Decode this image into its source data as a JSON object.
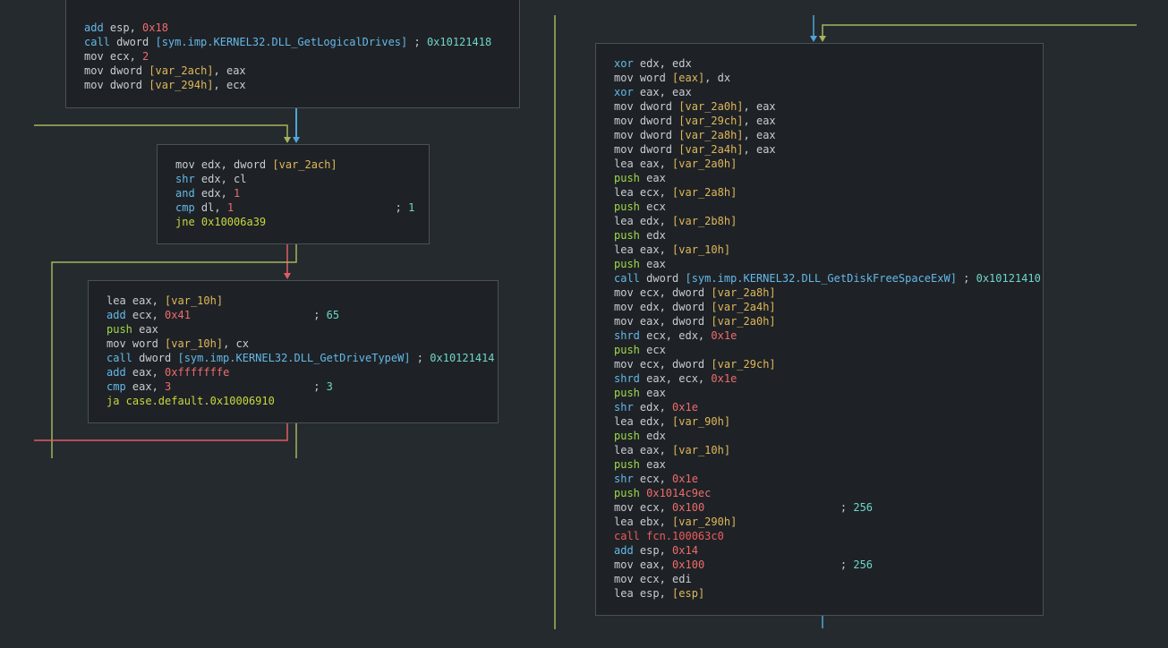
{
  "colors": {
    "background": "#252a2e",
    "block_bg": "#1e2226",
    "block_border": "#4b5055",
    "edge_true": "#9fc26a",
    "edge_false": "#e05c63",
    "edge_unconditional": "#4fa6d9",
    "edge_fallthrough": "#a6b55a"
  },
  "blocks": {
    "b1": {
      "lines": [
        {
          "m": "add",
          "mc": "add",
          "parts": [
            [
              "op",
              " esp, "
            ],
            [
              "num",
              "0x18"
            ]
          ]
        },
        {
          "m": "call",
          "mc": "call",
          "parts": [
            [
              "op",
              " dword "
            ],
            [
              "sym",
              "[sym.imp.KERNEL32.DLL_GetLogicalDrives]"
            ],
            [
              "op",
              " ; "
            ],
            [
              "comnum",
              "0x10121418"
            ]
          ]
        },
        {
          "m": "mov",
          "mc": "mn",
          "parts": [
            [
              "op",
              " ecx, "
            ],
            [
              "num",
              "2"
            ]
          ]
        },
        {
          "m": "mov",
          "mc": "mn",
          "parts": [
            [
              "op",
              " dword "
            ],
            [
              "var",
              "[var_2ach]"
            ],
            [
              "op",
              ", eax"
            ]
          ]
        },
        {
          "m": "mov",
          "mc": "mn",
          "parts": [
            [
              "op",
              " dword "
            ],
            [
              "var",
              "[var_294h]"
            ],
            [
              "op",
              ", ecx"
            ]
          ]
        }
      ]
    },
    "b2": {
      "lines": [
        {
          "m": "mov",
          "mc": "mn",
          "parts": [
            [
              "op",
              " edx, dword "
            ],
            [
              "var",
              "[var_2ach]"
            ]
          ]
        },
        {
          "m": "shr",
          "mc": "shr",
          "parts": [
            [
              "op",
              " edx, cl"
            ]
          ]
        },
        {
          "m": "and",
          "mc": "and",
          "parts": [
            [
              "op",
              " edx, "
            ],
            [
              "num",
              "1"
            ]
          ]
        },
        {
          "m": "cmp",
          "mc": "cmp",
          "parts": [
            [
              "op",
              " dl, "
            ],
            [
              "num",
              "1"
            ],
            [
              "op",
              "                         ; "
            ],
            [
              "comnum",
              "1"
            ]
          ]
        },
        {
          "m": "jne",
          "mc": "jmp",
          "parts": [
            [
              "jmp",
              " 0x10006a39"
            ]
          ]
        }
      ]
    },
    "b3": {
      "lines": [
        {
          "m": "lea",
          "mc": "mn",
          "parts": [
            [
              "op",
              " eax, "
            ],
            [
              "var",
              "[var_10h]"
            ]
          ]
        },
        {
          "m": "add",
          "mc": "add",
          "parts": [
            [
              "op",
              " ecx, "
            ],
            [
              "num",
              "0x41"
            ],
            [
              "op",
              "                   ; "
            ],
            [
              "comnum",
              "65"
            ]
          ]
        },
        {
          "m": "push",
          "mc": "push",
          "parts": [
            [
              "op",
              " eax"
            ]
          ]
        },
        {
          "m": "mov",
          "mc": "mn",
          "parts": [
            [
              "op",
              " word "
            ],
            [
              "var",
              "[var_10h]"
            ],
            [
              "op",
              ", cx"
            ]
          ]
        },
        {
          "m": "call",
          "mc": "call",
          "parts": [
            [
              "op",
              " dword "
            ],
            [
              "sym",
              "[sym.imp.KERNEL32.DLL_GetDriveTypeW]"
            ],
            [
              "op",
              " ; "
            ],
            [
              "comnum",
              "0x10121414"
            ]
          ]
        },
        {
          "m": "add",
          "mc": "add",
          "parts": [
            [
              "op",
              " eax, "
            ],
            [
              "num",
              "0xfffffffe"
            ]
          ]
        },
        {
          "m": "cmp",
          "mc": "cmp",
          "parts": [
            [
              "op",
              " eax, "
            ],
            [
              "num",
              "3"
            ],
            [
              "op",
              "                      ; "
            ],
            [
              "comnum",
              "3"
            ]
          ]
        },
        {
          "m": "ja",
          "mc": "jmp",
          "parts": [
            [
              "jmp",
              " case.default.0x10006910"
            ]
          ]
        }
      ]
    },
    "b4": {
      "lines": [
        {
          "m": "xor",
          "mc": "xor",
          "parts": [
            [
              "op",
              " edx, edx"
            ]
          ]
        },
        {
          "m": "mov",
          "mc": "mn",
          "parts": [
            [
              "op",
              " word "
            ],
            [
              "var",
              "[eax]"
            ],
            [
              "op",
              ", dx"
            ]
          ]
        },
        {
          "m": "xor",
          "mc": "xor",
          "parts": [
            [
              "op",
              " eax, eax"
            ]
          ]
        },
        {
          "m": "mov",
          "mc": "mn",
          "parts": [
            [
              "op",
              " dword "
            ],
            [
              "var",
              "[var_2a0h]"
            ],
            [
              "op",
              ", eax"
            ]
          ]
        },
        {
          "m": "mov",
          "mc": "mn",
          "parts": [
            [
              "op",
              " dword "
            ],
            [
              "var",
              "[var_29ch]"
            ],
            [
              "op",
              ", eax"
            ]
          ]
        },
        {
          "m": "mov",
          "mc": "mn",
          "parts": [
            [
              "op",
              " dword "
            ],
            [
              "var",
              "[var_2a8h]"
            ],
            [
              "op",
              ", eax"
            ]
          ]
        },
        {
          "m": "mov",
          "mc": "mn",
          "parts": [
            [
              "op",
              " dword "
            ],
            [
              "var",
              "[var_2a4h]"
            ],
            [
              "op",
              ", eax"
            ]
          ]
        },
        {
          "m": "lea",
          "mc": "mn",
          "parts": [
            [
              "op",
              " eax, "
            ],
            [
              "var",
              "[var_2a0h]"
            ]
          ]
        },
        {
          "m": "push",
          "mc": "push",
          "parts": [
            [
              "op",
              " eax"
            ]
          ]
        },
        {
          "m": "lea",
          "mc": "mn",
          "parts": [
            [
              "op",
              " ecx, "
            ],
            [
              "var",
              "[var_2a8h]"
            ]
          ]
        },
        {
          "m": "push",
          "mc": "push",
          "parts": [
            [
              "op",
              " ecx"
            ]
          ]
        },
        {
          "m": "lea",
          "mc": "mn",
          "parts": [
            [
              "op",
              " edx, "
            ],
            [
              "var",
              "[var_2b8h]"
            ]
          ]
        },
        {
          "m": "push",
          "mc": "push",
          "parts": [
            [
              "op",
              " edx"
            ]
          ]
        },
        {
          "m": "lea",
          "mc": "mn",
          "parts": [
            [
              "op",
              " eax, "
            ],
            [
              "var",
              "[var_10h]"
            ]
          ]
        },
        {
          "m": "push",
          "mc": "push",
          "parts": [
            [
              "op",
              " eax"
            ]
          ]
        },
        {
          "m": "call",
          "mc": "call",
          "parts": [
            [
              "op",
              " dword "
            ],
            [
              "sym",
              "[sym.imp.KERNEL32.DLL_GetDiskFreeSpaceExW]"
            ],
            [
              "op",
              " ; "
            ],
            [
              "comnum",
              "0x10121410"
            ]
          ]
        },
        {
          "m": "mov",
          "mc": "mn",
          "parts": [
            [
              "op",
              " ecx, dword "
            ],
            [
              "var",
              "[var_2a8h]"
            ]
          ]
        },
        {
          "m": "mov",
          "mc": "mn",
          "parts": [
            [
              "op",
              " edx, dword "
            ],
            [
              "var",
              "[var_2a4h]"
            ]
          ]
        },
        {
          "m": "mov",
          "mc": "mn",
          "parts": [
            [
              "op",
              " eax, dword "
            ],
            [
              "var",
              "[var_2a0h]"
            ]
          ]
        },
        {
          "m": "shrd",
          "mc": "shr",
          "parts": [
            [
              "op",
              " ecx, edx, "
            ],
            [
              "num",
              "0x1e"
            ]
          ]
        },
        {
          "m": "push",
          "mc": "push",
          "parts": [
            [
              "op",
              " ecx"
            ]
          ]
        },
        {
          "m": "mov",
          "mc": "mn",
          "parts": [
            [
              "op",
              " ecx, dword "
            ],
            [
              "var",
              "[var_29ch]"
            ]
          ]
        },
        {
          "m": "shrd",
          "mc": "shr",
          "parts": [
            [
              "op",
              " eax, ecx, "
            ],
            [
              "num",
              "0x1e"
            ]
          ]
        },
        {
          "m": "push",
          "mc": "push",
          "parts": [
            [
              "op",
              " eax"
            ]
          ]
        },
        {
          "m": "shr",
          "mc": "shr",
          "parts": [
            [
              "op",
              " edx, "
            ],
            [
              "num",
              "0x1e"
            ]
          ]
        },
        {
          "m": "lea",
          "mc": "mn",
          "parts": [
            [
              "op",
              " edx, "
            ],
            [
              "var",
              "[var_90h]"
            ]
          ]
        },
        {
          "m": "push",
          "mc": "push",
          "parts": [
            [
              "op",
              " edx"
            ]
          ]
        },
        {
          "m": "lea",
          "mc": "mn",
          "parts": [
            [
              "op",
              " eax, "
            ],
            [
              "var",
              "[var_10h]"
            ]
          ]
        },
        {
          "m": "push",
          "mc": "push",
          "parts": [
            [
              "op",
              " eax"
            ]
          ]
        },
        {
          "m": "shr",
          "mc": "shr",
          "parts": [
            [
              "op",
              " ecx, "
            ],
            [
              "num",
              "0x1e"
            ]
          ]
        },
        {
          "m": "push",
          "mc": "push",
          "parts": [
            [
              "num",
              " 0x1014c9ec"
            ]
          ]
        },
        {
          "m": "mov",
          "mc": "mn",
          "parts": [
            [
              "op",
              " ecx, "
            ],
            [
              "num",
              "0x100"
            ],
            [
              "op",
              "                     ; "
            ],
            [
              "comnum",
              "256"
            ]
          ]
        },
        {
          "m": "lea",
          "mc": "mn",
          "parts": [
            [
              "op",
              " ebx, "
            ],
            [
              "var",
              "[var_290h]"
            ]
          ]
        },
        {
          "m": "call",
          "mc": "callr",
          "parts": [
            [
              "callr",
              " fcn.100063c0"
            ]
          ]
        },
        {
          "m": "add",
          "mc": "add",
          "parts": [
            [
              "op",
              " esp, "
            ],
            [
              "num",
              "0x14"
            ]
          ]
        },
        {
          "m": "mov",
          "mc": "mn",
          "parts": [
            [
              "op",
              " eax, "
            ],
            [
              "num",
              "0x100"
            ],
            [
              "op",
              "                     ; "
            ],
            [
              "comnum",
              "256"
            ]
          ]
        },
        {
          "m": "mov",
          "mc": "mn",
          "parts": [
            [
              "op",
              " ecx, edi"
            ]
          ]
        },
        {
          "m": "lea",
          "mc": "mn",
          "parts": [
            [
              "op",
              " esp, "
            ],
            [
              "var",
              "[esp]"
            ]
          ]
        }
      ]
    }
  }
}
